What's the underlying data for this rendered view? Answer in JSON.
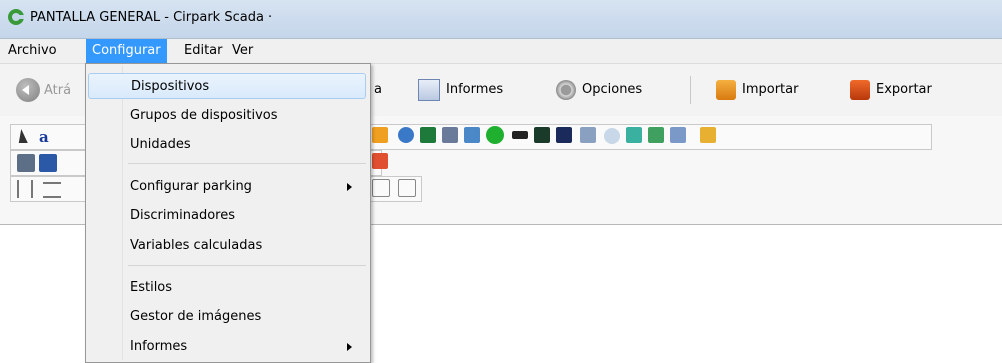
{
  "window": {
    "title": "PANTALLA GENERAL - Cirpark Scada ·"
  },
  "menubar": {
    "items": [
      "Archivo",
      "Configurar",
      "Editar",
      "Ver"
    ]
  },
  "toolbar": {
    "back_label": "Atrá",
    "partial_label": "a",
    "informes_label": "Informes",
    "opciones_label": "Opciones",
    "importar_label": "Importar",
    "exportar_label": "Exportar"
  },
  "dropdown": {
    "items": [
      {
        "label": "Dispositivos",
        "highlighted": true
      },
      {
        "label": "Grupos de dispositivos"
      },
      {
        "label": "Unidades"
      },
      {
        "label": "Configurar parking",
        "submenu": true
      },
      {
        "label": "Discriminadores"
      },
      {
        "label": "Variables calculadas"
      },
      {
        "label": "Estilos"
      },
      {
        "label": "Gestor de imágenes"
      },
      {
        "label": "Informes",
        "submenu": true
      }
    ]
  },
  "colors": {
    "menu_active": "#3399ff",
    "title_bar": "#c4d6ea"
  }
}
